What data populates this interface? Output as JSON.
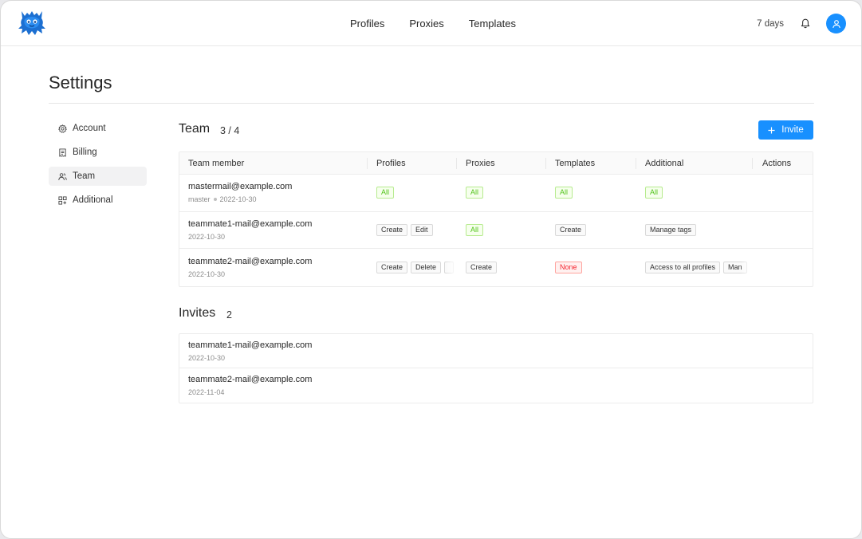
{
  "header": {
    "nav": [
      "Profiles",
      "Proxies",
      "Templates"
    ],
    "days_label": "7 days",
    "logo_icon": "octopus-logo-icon",
    "bell_icon": "bell-icon",
    "avatar_icon": "user-icon",
    "accent": "#1890ff"
  },
  "page": {
    "title": "Settings"
  },
  "sidebar": {
    "items": [
      {
        "label": "Account",
        "icon": "gear-icon"
      },
      {
        "label": "Billing",
        "icon": "receipt-icon"
      },
      {
        "label": "Team",
        "icon": "team-icon",
        "active": true
      },
      {
        "label": "Additional",
        "icon": "grid-icon"
      }
    ]
  },
  "team": {
    "title": "Team",
    "count": "3 / 4",
    "invite_label": "Invite",
    "columns": [
      "Team member",
      "Profiles",
      "Proxies",
      "Templates",
      "Additional",
      "Actions"
    ],
    "rows": [
      {
        "email": "mastermail@example.com",
        "role": "master",
        "date": "2022-10-30",
        "profiles": [
          {
            "text": "All",
            "style": "green"
          }
        ],
        "proxies": [
          {
            "text": "All",
            "style": "green"
          }
        ],
        "templates": [
          {
            "text": "All",
            "style": "green"
          }
        ],
        "additional": [
          {
            "text": "All",
            "style": "green"
          }
        ]
      },
      {
        "email": "teammate1-mail@example.com",
        "date": "2022-10-30",
        "profiles": [
          {
            "text": "Create"
          },
          {
            "text": "Edit"
          }
        ],
        "proxies": [
          {
            "text": "All",
            "style": "green"
          }
        ],
        "templates": [
          {
            "text": "Create"
          }
        ],
        "additional": [
          {
            "text": "Manage tags"
          }
        ]
      },
      {
        "email": "teammate2-mail@example.com",
        "date": "2022-10-30",
        "profiles": [
          {
            "text": "Create"
          },
          {
            "text": "Delete"
          }
        ],
        "proxies": [
          {
            "text": "Create"
          }
        ],
        "templates": [
          {
            "text": "None",
            "style": "red"
          }
        ],
        "additional": [
          {
            "text": "Access to all profiles"
          },
          {
            "text": "Man"
          }
        ]
      }
    ]
  },
  "invites": {
    "title": "Invites",
    "count": "2",
    "rows": [
      {
        "email": "teammate1-mail@example.com",
        "date": "2022-10-30"
      },
      {
        "email": "teammate2-mail@example.com",
        "date": "2022-11-04"
      }
    ]
  }
}
